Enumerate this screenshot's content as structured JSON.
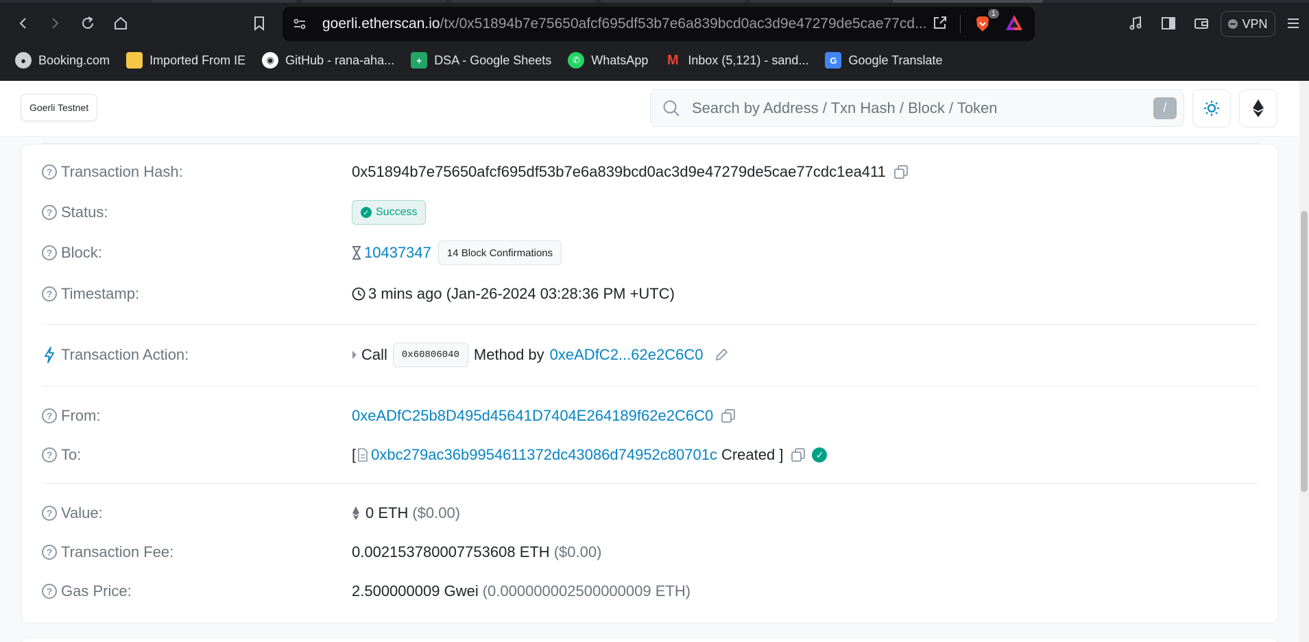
{
  "browser": {
    "url_host": "goerli.etherscan.io",
    "url_path": "/tx/0x51894b7e75650afcf695df53b7e6a839bcd0ac3d9e47279de5cae77cd...",
    "shield_count": "1",
    "vpn_label": "VPN",
    "bookmarks": [
      {
        "label": "Booking.com",
        "icon": "globe-icon",
        "color": "#cfd0d4"
      },
      {
        "label": "Imported From IE",
        "icon": "folder-icon",
        "color": "#f6c744"
      },
      {
        "label": "GitHub - rana-aha...",
        "icon": "github-icon",
        "color": "#ffffff"
      },
      {
        "label": "DSA - Google Sheets",
        "icon": "sheets-icon",
        "color": "#23a566"
      },
      {
        "label": "WhatsApp",
        "icon": "whatsapp-icon",
        "color": "#25d366"
      },
      {
        "label": "Inbox (5,121) - sand...",
        "icon": "gmail-icon",
        "color": "#ea4335"
      },
      {
        "label": "Google Translate",
        "icon": "translate-icon",
        "color": "#4285f4"
      }
    ]
  },
  "header": {
    "network": "Goerli Testnet",
    "search_placeholder": "Search by Address / Txn Hash / Block / Token",
    "search_shortcut": "/"
  },
  "tx": {
    "hash_label": "Transaction Hash:",
    "hash": "0x51894b7e75650afcf695df53b7e6a839bcd0ac3d9e47279de5cae77cdc1ea411",
    "status_label": "Status:",
    "status": "Success",
    "block_label": "Block:",
    "block": "10437347",
    "confirmations": "14 Block Confirmations",
    "timestamp_label": "Timestamp:",
    "timestamp": "3 mins ago (Jan-26-2024 03:28:36 PM +UTC)",
    "action_label": "Transaction Action:",
    "action_call": "Call",
    "action_method": "0x60806040",
    "action_method_by": "Method by",
    "action_address": "0xeADfC2...62e2C6C0",
    "from_label": "From:",
    "from": "0xeADfC25b8D495d45641D7404E264189f62e2C6C0",
    "to_label": "To:",
    "to_open": "[",
    "to_address": "0xbc279ac36b9954611372dc43086d74952c80701c",
    "to_created": "Created ]",
    "value_label": "Value:",
    "value_eth": "0 ETH",
    "value_usd": "($0.00)",
    "fee_label": "Transaction Fee:",
    "fee_eth": "0.002153780007753608 ETH",
    "fee_usd": "($0.00)",
    "gas_label": "Gas Price:",
    "gas_gwei": "2.500000009 Gwei",
    "gas_eth": "(0.000000002500000009 ETH)"
  },
  "colors": {
    "link": "#0784c3",
    "success": "#00a186",
    "muted": "#6c757d"
  }
}
